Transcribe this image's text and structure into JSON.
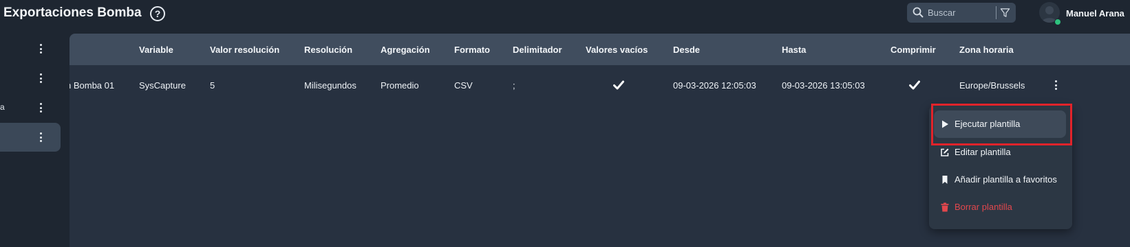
{
  "header": {
    "title": "Exportaciones Bomba",
    "help_symbol": "?",
    "search_placeholder": "Buscar",
    "user_name": "Manuel Arana",
    "status_color": "#2ec27e"
  },
  "sidebar": {
    "items": [
      {
        "label": "",
        "active": false
      },
      {
        "label": "",
        "active": false
      },
      {
        "label": "a",
        "active": false
      },
      {
        "label": "",
        "active": true
      }
    ]
  },
  "table": {
    "columns": [
      "Variable",
      "Valor resolución",
      "Resolución",
      "Agregación",
      "Formato",
      "Delimitador",
      "Valores vacíos",
      "Desde",
      "Hasta",
      "Comprimir",
      "Zona horaria"
    ],
    "rows": [
      {
        "name": "n Bomba 01",
        "variable": "SysCapture",
        "valor_resolucion": "5",
        "resolucion": "Milisegundos",
        "agregacion": "Promedio",
        "formato": "CSV",
        "delimitador": ";",
        "valores_vacios": true,
        "desde": "09-03-2026 12:05:03",
        "hasta": "09-03-2026 13:05:03",
        "comprimir": true,
        "zona_horaria": "Europe/Brussels"
      }
    ]
  },
  "menu": {
    "items": [
      {
        "label": "Ejecutar plantilla",
        "icon": "play-icon",
        "highlighted": true
      },
      {
        "label": "Editar plantilla",
        "icon": "edit-icon",
        "highlighted": false
      },
      {
        "label": "Añadir plantilla a favoritos",
        "icon": "bookmark-icon",
        "highlighted": false
      },
      {
        "label": "Borrar plantilla",
        "icon": "trash-icon",
        "highlighted": false,
        "danger": true
      }
    ],
    "danger_color": "#e2474d",
    "highlight_color": "#e2232a"
  }
}
